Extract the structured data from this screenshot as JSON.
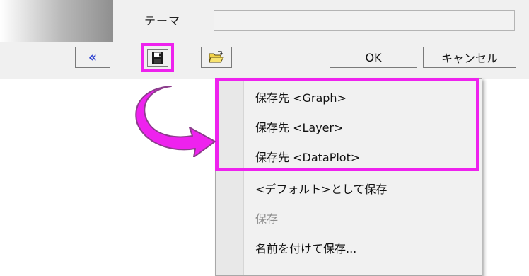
{
  "dialog": {
    "theme_label": "テーマ",
    "theme_value": "",
    "collapse_icon": "«",
    "ok_label": "OK",
    "cancel_label": "キャンセル"
  },
  "icons": {
    "collapse": "double-chevron-left-icon",
    "save": "floppy-disk-icon",
    "open": "open-folder-icon",
    "annotation_arrow": "curved-arrow-icon"
  },
  "menu": {
    "items": [
      {
        "label": "保存先 <Graph>",
        "enabled": true
      },
      {
        "label": "保存先 <Layer>",
        "enabled": true
      },
      {
        "label": "保存先 <DataPlot>",
        "enabled": true
      },
      {
        "label": "<デフォルト>として保存",
        "enabled": true
      },
      {
        "label": "保存",
        "enabled": false
      },
      {
        "label": "名前を付けて保存...",
        "enabled": true
      }
    ]
  },
  "colors": {
    "highlight": "#ee22ee",
    "collapse_icon": "#2a3fd0",
    "disabled_text": "#8c8c8c"
  }
}
